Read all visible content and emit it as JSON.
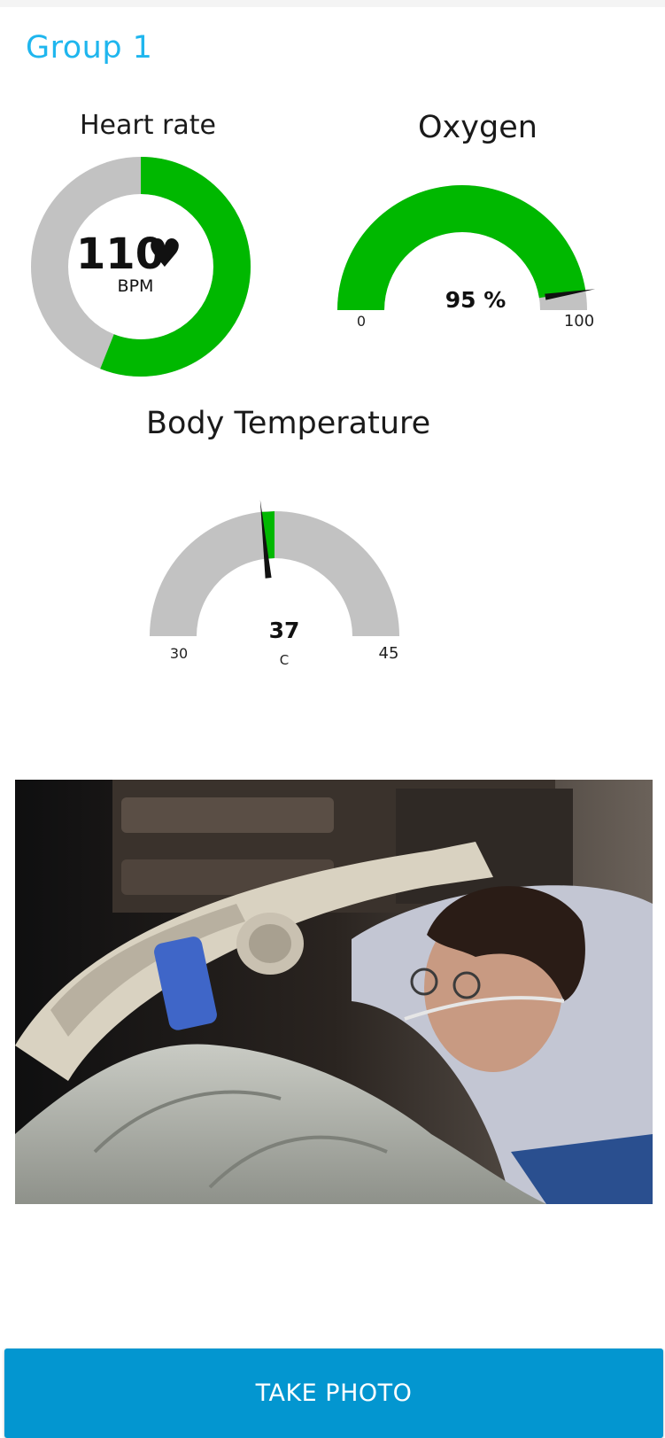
{
  "header": {
    "title": "Group 1"
  },
  "heart_rate": {
    "title": "Heart rate",
    "value": "110",
    "heart_glyph": "♥",
    "unit": "BPM",
    "fill_fraction": 0.56,
    "fill_color": "#00b800",
    "track_color": "#c2c2c2"
  },
  "oxygen": {
    "title": "Oxygen",
    "value_text": "95 %",
    "value": 95,
    "min": 0,
    "max": 100,
    "min_label": "0",
    "max_label": "100",
    "fill_color": "#00b800",
    "track_color": "#c2c2c2"
  },
  "body_temperature": {
    "title": "Body Temperature",
    "value_text": "37",
    "value": 37,
    "min": 30,
    "max": 45,
    "min_label": "30",
    "max_label": "45",
    "unit": "C",
    "fill_color": "#00b800",
    "track_color": "#c2c2c2"
  },
  "photo": {
    "subject": "patient-in-hospital-bed-photo"
  },
  "actions": {
    "take_photo_label": "TAKE PHOTO",
    "button_color": "#0396d0"
  },
  "accent_color": "#1fb6ee"
}
